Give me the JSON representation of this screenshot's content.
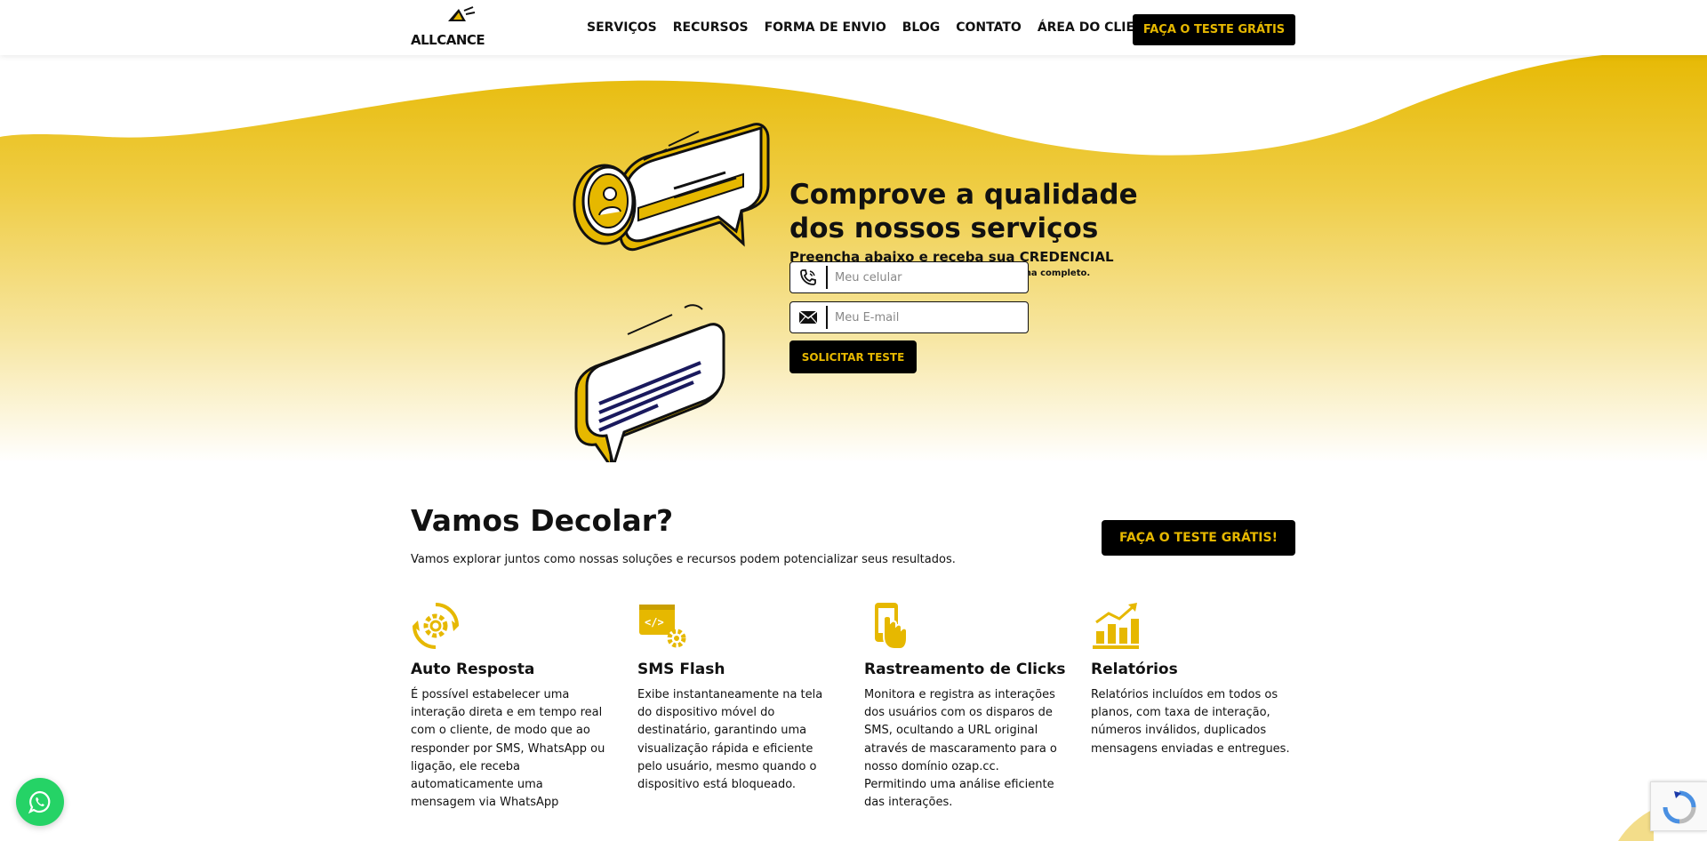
{
  "header": {
    "logo_text": "ALLCANCE",
    "nav": [
      "SERVIÇOS",
      "RECURSOS",
      "FORMA DE ENVIO",
      "BLOG",
      "CONTATO",
      "ÁREA DO CLIENTE"
    ],
    "cta": "FAÇA O TESTE GRÁTIS"
  },
  "hero": {
    "title": "Comprove a qualidade dos nossos serviços",
    "subtitle": "Preencha abaixo e receba sua CREDENCIAL",
    "note": "Você ganhará CRÉDITOS para conhecer o sistema completo.",
    "phone_placeholder": "Meu celular",
    "email_placeholder": "Meu E-mail",
    "submit_label": "SOLICITAR TESTE"
  },
  "section": {
    "title": "Vamos Decolar?",
    "subtitle": "Vamos explorar juntos como nossas soluções e recursos podem potencializar seus resultados.",
    "cta": "FAÇA O TESTE GRÁTIS!"
  },
  "features": [
    {
      "icon": "gear-cycle-icon",
      "title": "Auto Resposta",
      "text": "É possível estabelecer uma interação direta e em tempo real com o cliente, de modo que ao responder por SMS, WhatsApp ou ligação, ele receba automaticamente uma mensagem via WhatsApp"
    },
    {
      "icon": "code-gear-icon",
      "title": "SMS Flash",
      "text": "Exibe instantaneamente na tela do dispositivo móvel do destinatário, garantindo uma visualização rápida e eficiente pelo usuário, mesmo quando o dispositivo está bloqueado."
    },
    {
      "icon": "phone-touch-icon",
      "title": "Rastreamento de Clicks",
      "text": "Monitora e registra as interações dos usuários com os disparos de SMS, ocultando a URL original através de mascaramento para o nosso domínio ozap.cc. Permitindo uma análise eficiente das interações."
    },
    {
      "icon": "bar-chart-icon",
      "title": "Relatórios",
      "text": "Relatórios incluídos em todos os planos, com taxa de interação, números inválidos, duplicados mensagens enviadas e entregues."
    }
  ],
  "colors": {
    "accent": "#e6b800",
    "dark": "#000000",
    "whatsapp": "#25d366"
  }
}
